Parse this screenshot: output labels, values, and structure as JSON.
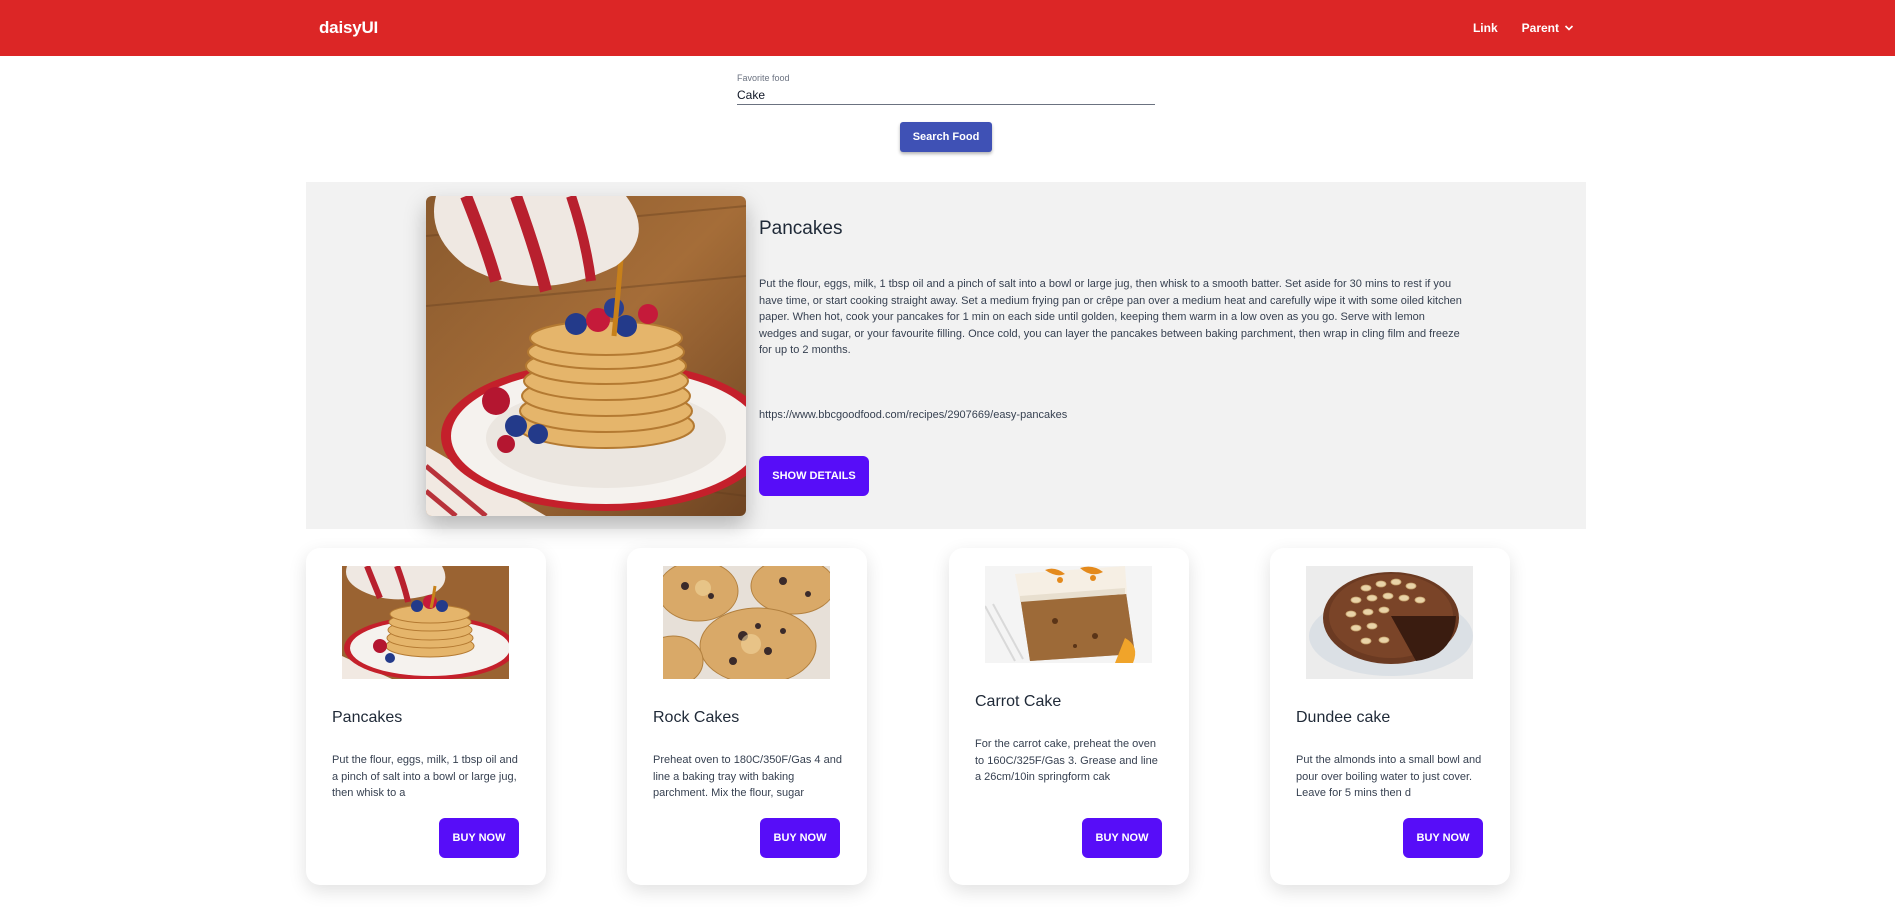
{
  "navbar": {
    "brand": "daisyUI",
    "link": "Link",
    "parent": "Parent",
    "bg_color": "#dc2626"
  },
  "search": {
    "label": "Favorite food",
    "value": "Cake",
    "button": "Search Food"
  },
  "hero": {
    "image_icon": "pancakes-photo",
    "title": "Pancakes",
    "description": "Put the flour, eggs, milk, 1 tbsp oil and a pinch of salt into a bowl or large jug, then whisk to a smooth batter. Set aside for 30 mins to rest if you have time, or start cooking straight away. Set a medium frying pan or crêpe pan over a medium heat and carefully wipe it with some oiled kitchen paper. When hot, cook your pancakes for 1 min on each side until golden, keeping them warm in a low oven as you go. Serve with lemon wedges and sugar, or your favourite filling. Once cold, you can layer the pancakes between baking parchment, then wrap in cling film and freeze for up to 2 months.",
    "link": "https://www.bbcgoodfood.com/recipes/2907669/easy-pancakes",
    "button": "SHOW DETAILS"
  },
  "cards": [
    {
      "image_icon": "pancakes-photo",
      "title": "Pancakes",
      "text": "Put the flour, eggs, milk, 1 tbsp oil and a pinch of salt into a bowl or large jug, then whisk to a",
      "button": "BUY NOW"
    },
    {
      "image_icon": "rock-cakes-photo",
      "title": "Rock Cakes",
      "text": "Preheat oven to 180C/350F/Gas 4 and line a baking tray with baking parchment. Mix the flour, sugar",
      "button": "BUY NOW"
    },
    {
      "image_icon": "carrot-cake-photo",
      "title": "Carrot Cake",
      "text": "For the carrot cake, preheat the oven to 160C/325F/Gas 3. Grease and line a 26cm/10in springform cak",
      "button": "BUY NOW"
    },
    {
      "image_icon": "dundee-cake-photo",
      "title": "Dundee cake",
      "text": "Put the almonds into a small bowl and pour over boiling water to just cover. Leave for 5 mins then d",
      "button": "BUY NOW"
    }
  ],
  "colors": {
    "primary": "#570df8",
    "search_button": "#3f51b5",
    "hero_bg": "#f2f2f2"
  }
}
